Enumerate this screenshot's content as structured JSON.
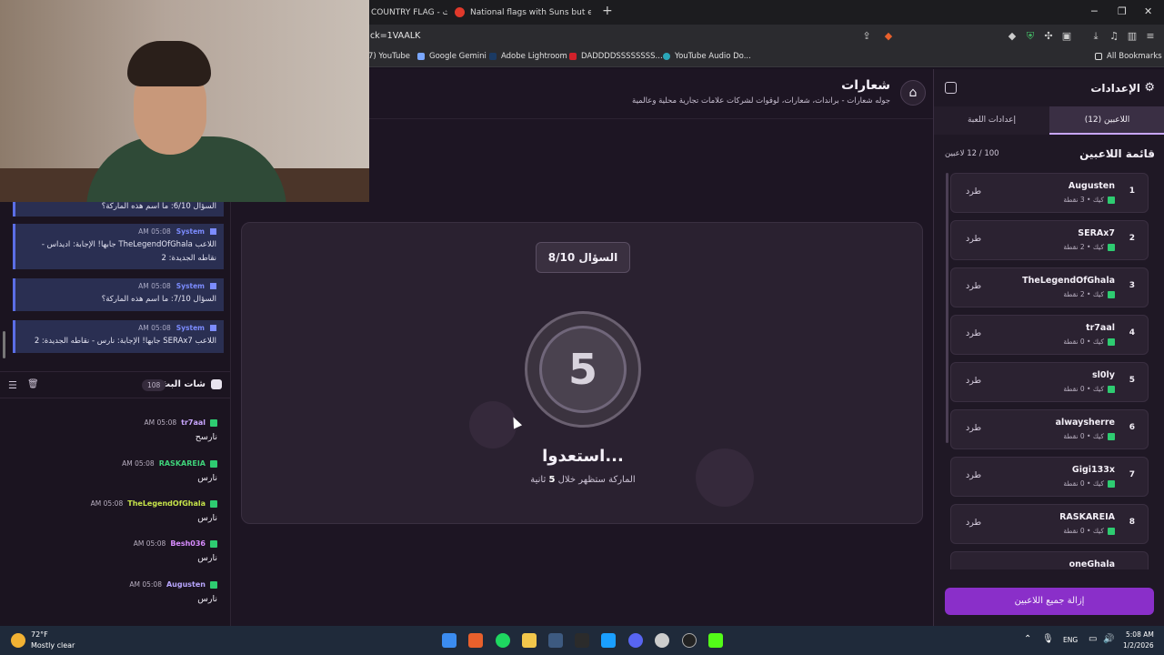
{
  "browser": {
    "tabs": [
      {
        "title": "COUNTRY FLAG - جث"
      },
      {
        "title": "National flags with Suns but every su"
      }
    ],
    "new_tab": "+",
    "url": "ck=1VAALK",
    "bookmarks": [
      {
        "label": "7) YouTube"
      },
      {
        "label": "Google Gemini"
      },
      {
        "label": "Adobe Lightroom"
      },
      {
        "label": "DADDDDSSSSSSSS..."
      },
      {
        "label": "YouTube Audio Do..."
      }
    ],
    "all_bookmarks": "All Bookmarks"
  },
  "header": {
    "title": "شعارات",
    "subtitle": "جوله شعارات - براندات، شعارات، لوقوات لشركات علامات تجارية محلية وعالمية"
  },
  "game": {
    "question_label": "السؤال 8/10",
    "timer": "5",
    "ready": "استعدوا...",
    "countdown_prefix": "الماركة ستظهر خلال",
    "countdown_value": "5",
    "countdown_suffix": "ثانية"
  },
  "system_messages": [
    {
      "name": "",
      "time": "",
      "text": "السؤال 6/10: ما اسم هذه الماركة؟"
    },
    {
      "name": "System",
      "time": "AM 05:08",
      "text": "اللاعب TheLegendOfGhala جابها! الإجابة: اديداس - نقاطه الجديدة: 2"
    },
    {
      "name": "System",
      "time": "AM 05:08",
      "text": "السؤال 7/10: ما اسم هذه الماركة؟"
    },
    {
      "name": "System",
      "time": "AM 05:08",
      "text": "اللاعب SERAx7 جابها! الإجابة: نارس - نقاطه الجديدة: 2"
    }
  ],
  "chat": {
    "title": "شات البث",
    "count": "108",
    "messages": [
      {
        "name": "tr7aal",
        "time": "AM 05:08",
        "text": "نارسح",
        "color": "#c9a6ff"
      },
      {
        "name": "RASKAREIA",
        "time": "AM 05:08",
        "text": "نارس",
        "color": "#3fd27a"
      },
      {
        "name": "TheLegendOfGhala",
        "time": "AM 05:08",
        "text": "نارس",
        "color": "#c6e34a"
      },
      {
        "name": "Besh036",
        "time": "AM 05:08",
        "text": "نارس",
        "color": "#d88cff"
      },
      {
        "name": "Augusten",
        "time": "AM 05:08",
        "text": "نارس",
        "color": "#b9a7ff"
      }
    ]
  },
  "settings": {
    "title": "الإعدادات",
    "tab_players": "اللاعبين (12)",
    "tab_game": "إعدادات اللعبة",
    "players_title": "قائمة اللاعبين",
    "players_count": "100 / 12 لاعبين",
    "kick_label": "طرد",
    "remove_all": "إزالة جميع اللاعبين",
    "players": [
      {
        "rank": "1",
        "name": "Augusten",
        "meta": "كيك • 3 نقطة"
      },
      {
        "rank": "2",
        "name": "SERAx7",
        "meta": "كيك • 2 نقطة"
      },
      {
        "rank": "3",
        "name": "TheLegendOfGhala",
        "meta": "كيك • 2 نقطة"
      },
      {
        "rank": "4",
        "name": "tr7aal",
        "meta": "كيك • 0 نقطة"
      },
      {
        "rank": "5",
        "name": "sl0ly",
        "meta": "كيك • 0 نقطة"
      },
      {
        "rank": "6",
        "name": "alwaysherre",
        "meta": "كيك • 0 نقطة"
      },
      {
        "rank": "7",
        "name": "Gigi133x",
        "meta": "كيك • 0 نقطة"
      },
      {
        "rank": "8",
        "name": "RASKAREIA",
        "meta": "كيك • 0 نقطة"
      },
      {
        "rank": "",
        "name": "oneGhala",
        "meta": ""
      }
    ]
  },
  "taskbar": {
    "temp": "72°F",
    "weather": "Mostly clear",
    "lang": "ENG",
    "time": "5:08 AM",
    "date": "1/2/2026"
  }
}
